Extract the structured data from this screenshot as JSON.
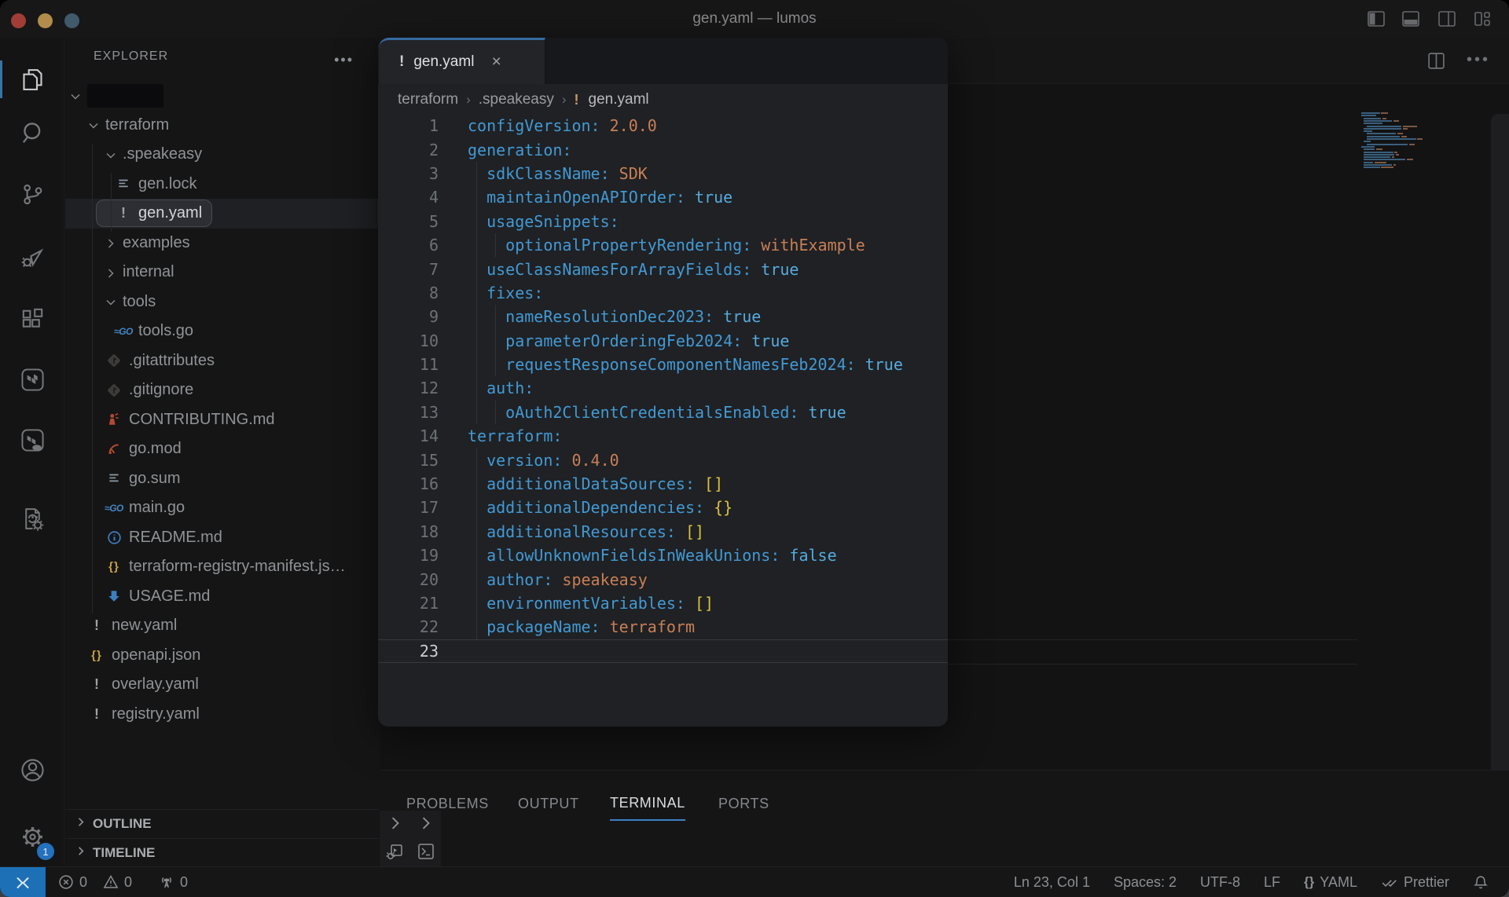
{
  "window": {
    "title": "gen.yaml — lumos"
  },
  "titlebar": {
    "traffic_lights": [
      "close",
      "minimize",
      "zoom"
    ],
    "controls": [
      "toggle-primary-sidebar",
      "toggle-panel",
      "toggle-secondary-sidebar",
      "customize-layout"
    ]
  },
  "activity_bar": {
    "items": [
      {
        "icon": "files",
        "active": true
      },
      {
        "icon": "search",
        "active": false
      },
      {
        "icon": "source-control",
        "active": false
      },
      {
        "icon": "run-debug",
        "active": false
      },
      {
        "icon": "extensions",
        "active": false
      },
      {
        "icon": "terraform",
        "active": false
      },
      {
        "icon": "terraform-cloud",
        "active": false
      },
      {
        "icon": "cpp-tools",
        "active": false
      },
      {
        "icon": "accounts",
        "active": false
      },
      {
        "icon": "settings-gear",
        "active": false,
        "badge": "1"
      }
    ],
    "settings_badge": "1"
  },
  "explorer": {
    "header": "EXPLORER",
    "more_label": "···",
    "tree": [
      {
        "label": "",
        "depth": 0,
        "kind": "folder",
        "expanded": true,
        "redacted": true
      },
      {
        "label": "terraform",
        "depth": 1,
        "kind": "folder",
        "expanded": true
      },
      {
        "label": ".speakeasy",
        "depth": 2,
        "kind": "folder",
        "expanded": true
      },
      {
        "label": "gen.lock",
        "depth": 3,
        "kind": "file",
        "icon": "list"
      },
      {
        "label": "gen.yaml",
        "depth": 3,
        "kind": "file",
        "icon": "warn",
        "selected": true
      },
      {
        "label": "examples",
        "depth": 2,
        "kind": "folder",
        "expanded": false
      },
      {
        "label": "internal",
        "depth": 2,
        "kind": "folder",
        "expanded": false
      },
      {
        "label": "tools",
        "depth": 2,
        "kind": "folder",
        "expanded": true
      },
      {
        "label": "tools.go",
        "depth": 3,
        "kind": "file",
        "icon": "go"
      },
      {
        "label": ".gitattributes",
        "depth": 2,
        "kind": "file",
        "icon": "git"
      },
      {
        "label": ".gitignore",
        "depth": 2,
        "kind": "file",
        "icon": "git"
      },
      {
        "label": "CONTRIBUTING.md",
        "depth": 2,
        "kind": "file",
        "icon": "contrib"
      },
      {
        "label": "go.mod",
        "depth": 2,
        "kind": "file",
        "icon": "gomod"
      },
      {
        "label": "go.sum",
        "depth": 2,
        "kind": "file",
        "icon": "list"
      },
      {
        "label": "main.go",
        "depth": 2,
        "kind": "file",
        "icon": "go"
      },
      {
        "label": "README.md",
        "depth": 2,
        "kind": "file",
        "icon": "info"
      },
      {
        "label": "terraform-registry-manifest.js…",
        "depth": 2,
        "kind": "file",
        "icon": "json"
      },
      {
        "label": "USAGE.md",
        "depth": 2,
        "kind": "file",
        "icon": "usage"
      },
      {
        "label": "new.yaml",
        "depth": 1,
        "kind": "file",
        "icon": "warn"
      },
      {
        "label": "openapi.json",
        "depth": 1,
        "kind": "file",
        "icon": "json"
      },
      {
        "label": "overlay.yaml",
        "depth": 1,
        "kind": "file",
        "icon": "warn"
      },
      {
        "label": "registry.yaml",
        "depth": 1,
        "kind": "file",
        "icon": "warn"
      }
    ],
    "sections": [
      "OUTLINE",
      "TIMELINE"
    ]
  },
  "editor": {
    "tab": {
      "label": "gen.yaml",
      "icon": "warn",
      "close": "×"
    },
    "breadcrumb": [
      "terraform",
      ".speakeasy",
      "gen.yaml"
    ],
    "code_lines": [
      {
        "n": 1,
        "indent": 0,
        "key": "configVersion",
        "value": "2.0.0",
        "vt": "str"
      },
      {
        "n": 2,
        "indent": 0,
        "key": "generation",
        "value": "",
        "vt": ""
      },
      {
        "n": 3,
        "indent": 2,
        "key": "sdkClassName",
        "value": "SDK",
        "vt": "str"
      },
      {
        "n": 4,
        "indent": 2,
        "key": "maintainOpenAPIOrder",
        "value": "true",
        "vt": "bool"
      },
      {
        "n": 5,
        "indent": 2,
        "key": "usageSnippets",
        "value": "",
        "vt": ""
      },
      {
        "n": 6,
        "indent": 4,
        "key": "optionalPropertyRendering",
        "value": "withExample",
        "vt": "str"
      },
      {
        "n": 7,
        "indent": 2,
        "key": "useClassNamesForArrayFields",
        "value": "true",
        "vt": "bool"
      },
      {
        "n": 8,
        "indent": 2,
        "key": "fixes",
        "value": "",
        "vt": ""
      },
      {
        "n": 9,
        "indent": 4,
        "key": "nameResolutionDec2023",
        "value": "true",
        "vt": "bool"
      },
      {
        "n": 10,
        "indent": 4,
        "key": "parameterOrderingFeb2024",
        "value": "true",
        "vt": "bool"
      },
      {
        "n": 11,
        "indent": 4,
        "key": "requestResponseComponentNamesFeb2024",
        "value": "true",
        "vt": "bool"
      },
      {
        "n": 12,
        "indent": 2,
        "key": "auth",
        "value": "",
        "vt": ""
      },
      {
        "n": 13,
        "indent": 4,
        "key": "oAuth2ClientCredentialsEnabled",
        "value": "true",
        "vt": "bool"
      },
      {
        "n": 14,
        "indent": 0,
        "key": "terraform",
        "value": "",
        "vt": ""
      },
      {
        "n": 15,
        "indent": 2,
        "key": "version",
        "value": "0.4.0",
        "vt": "str"
      },
      {
        "n": 16,
        "indent": 2,
        "key": "additionalDataSources",
        "value": "[]",
        "vt": "br"
      },
      {
        "n": 17,
        "indent": 2,
        "key": "additionalDependencies",
        "value": "{}",
        "vt": "br"
      },
      {
        "n": 18,
        "indent": 2,
        "key": "additionalResources",
        "value": "[]",
        "vt": "br"
      },
      {
        "n": 19,
        "indent": 2,
        "key": "allowUnknownFieldsInWeakUnions",
        "value": "false",
        "vt": "bool"
      },
      {
        "n": 20,
        "indent": 2,
        "key": "author",
        "value": "speakeasy",
        "vt": "str"
      },
      {
        "n": 21,
        "indent": 2,
        "key": "environmentVariables",
        "value": "[]",
        "vt": "br"
      },
      {
        "n": 22,
        "indent": 2,
        "key": "packageName",
        "value": "terraform",
        "vt": "str"
      },
      {
        "n": 23,
        "indent": 0,
        "key": "",
        "value": "",
        "vt": "",
        "current": true
      }
    ]
  },
  "panel": {
    "tabs": [
      {
        "label": "PROBLEMS",
        "active": false
      },
      {
        "label": "OUTPUT",
        "active": false
      },
      {
        "label": "TERMINAL",
        "active": true
      },
      {
        "label": "PORTS",
        "active": false
      }
    ]
  },
  "status_bar": {
    "left": [
      {
        "icon": "error",
        "text": "0"
      },
      {
        "icon": "warning",
        "text": "0"
      },
      {
        "icon": "radio-tower",
        "text": "0"
      }
    ],
    "right": [
      {
        "text": "Ln 23, Col 1"
      },
      {
        "text": "Spaces: 2"
      },
      {
        "text": "UTF-8"
      },
      {
        "text": "LF"
      },
      {
        "icon": "braces",
        "text": "YAML"
      },
      {
        "icon": "double-check",
        "text": "Prettier"
      },
      {
        "icon": "bell",
        "text": ""
      }
    ]
  },
  "colors": {
    "accent_blue": "#3b80c4",
    "syntax_key": "#4399d4",
    "syntax_string": "#c97f56",
    "syntax_bool": "#56abdf",
    "syntax_bracket": "#d9c13f",
    "traffic": [
      "#a13d36",
      "#b28c4a",
      "#40596b"
    ]
  }
}
